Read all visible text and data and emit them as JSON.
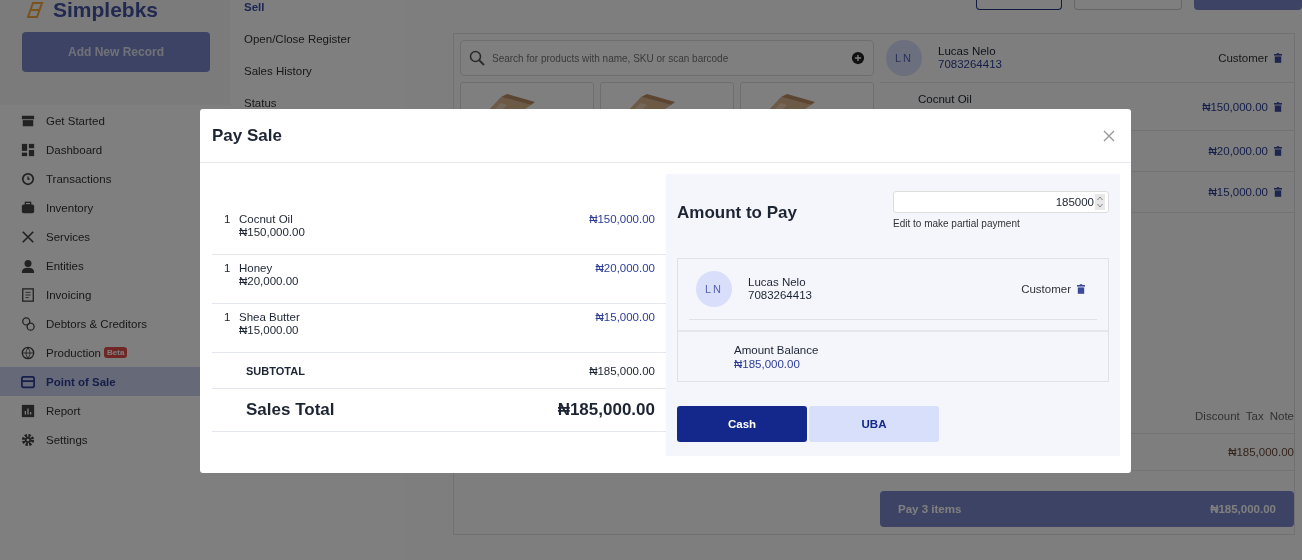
{
  "app": {
    "brand": "Simplebks",
    "add_button": "Add New Record"
  },
  "sidebar": {
    "items": [
      {
        "label": "Get Started",
        "selected": false
      },
      {
        "label": "Dashboard",
        "selected": false
      },
      {
        "label": "Transactions",
        "selected": false
      },
      {
        "label": "Inventory",
        "selected": false
      },
      {
        "label": "Services",
        "selected": false
      },
      {
        "label": "Entities",
        "selected": false
      },
      {
        "label": "Invoicing",
        "selected": false
      },
      {
        "label": "Debtors & Creditors",
        "selected": false
      },
      {
        "label": "Production",
        "selected": false,
        "badge": "Beta"
      },
      {
        "label": "Point of Sale",
        "selected": true
      },
      {
        "label": "Report",
        "selected": false
      },
      {
        "label": "Settings",
        "selected": false
      }
    ]
  },
  "submenu": {
    "items": [
      "Sell",
      "Open/Close Register",
      "Sales History",
      "Status"
    ]
  },
  "pos": {
    "search_placeholder": "Search for products with name, SKU or scan barcode",
    "products": [
      {
        "kind": "picture"
      },
      {
        "kind": "picture"
      },
      {
        "kind": "picture"
      }
    ],
    "customer": {
      "initials": "LN",
      "name": "Lucas Nelo",
      "phone": "7083264413",
      "role": "Customer"
    },
    "cart_items": [
      {
        "name": "Cocnut Oil",
        "price": "₦150,000.00"
      },
      {
        "price": "₦20,000.00"
      },
      {
        "price": "₦15,000.00"
      }
    ],
    "columns": [
      "Discount",
      "Tax",
      "Note"
    ],
    "total": "₦185,000.00",
    "pay_button": {
      "label": "Pay 3 items",
      "amount": "₦185,000.00"
    }
  },
  "modal": {
    "title": "Pay Sale",
    "items": [
      {
        "qty": "1",
        "name": "Cocnut Oil",
        "unit_price": "₦150,000.00",
        "line_total": "₦150,000.00"
      },
      {
        "qty": "1",
        "name": "Honey",
        "unit_price": "₦20,000.00",
        "line_total": "₦20,000.00"
      },
      {
        "qty": "1",
        "name": "Shea Butter",
        "unit_price": "₦15,000.00",
        "line_total": "₦15,000.00"
      }
    ],
    "subtotal_label": "SUBTOTAL",
    "subtotal": "₦185,000.00",
    "total_label": "Sales Total",
    "total": "₦185,000.00",
    "amount_heading": "Amount to Pay",
    "amount_value": "185000",
    "amount_hint": "Edit to make partial payment",
    "customer": {
      "initials": "LN",
      "name": "Lucas Nelo",
      "phone": "7083264413",
      "role": "Customer"
    },
    "balance_label": "Amount Balance",
    "balance": "₦185,000.00",
    "methods": [
      {
        "label": "Cash",
        "selected": true
      },
      {
        "label": "UBA",
        "selected": false
      }
    ]
  }
}
